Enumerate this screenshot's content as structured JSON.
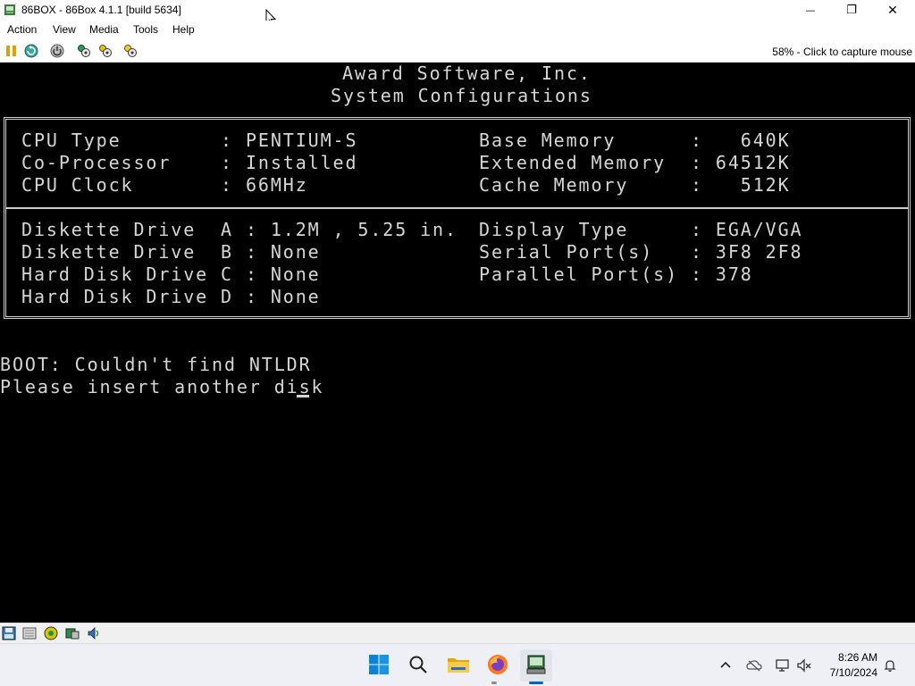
{
  "window": {
    "title": "86BOX - 86Box 4.1.1 [build 5634]",
    "minimize_glyph": "—",
    "maximize_glyph": "❐",
    "close_glyph": "✕"
  },
  "menu": [
    {
      "label": "Action"
    },
    {
      "label": "View"
    },
    {
      "label": "Media"
    },
    {
      "label": "Tools"
    },
    {
      "label": "Help"
    }
  ],
  "toolbar": {
    "icons": [
      "pause-icon",
      "reset-icon",
      "power-icon",
      "settings-icon",
      "hard-reset-icon",
      "ctrl-alt-del-icon"
    ],
    "capture_text": "58% - Click to capture mouse"
  },
  "bios": {
    "vendor": "Award Software, Inc.",
    "heading": "System Configurations",
    "left_top": [
      "CPU Type        : PENTIUM-S",
      "Co-Processor    : Installed",
      "CPU Clock       : 66MHz"
    ],
    "right_top": [
      "Base Memory      :   640K",
      "Extended Memory  : 64512K",
      "Cache Memory     :   512K"
    ],
    "left_bottom": [
      "Diskette Drive  A : 1.2M , 5.25 in.",
      "Diskette Drive  B : None",
      "Hard Disk Drive C : None",
      "Hard Disk Drive D : None"
    ],
    "right_bottom": [
      "Display Type     : EGA/VGA",
      "Serial Port(s)   : 3F8 2F8",
      "Parallel Port(s) : 378"
    ],
    "boot_line1": "BOOT: Couldn't find NTLDR",
    "boot_line2": "Please insert another disk"
  },
  "statusbar": {
    "icons": [
      "floppy-icon",
      "cdrom-icon",
      "network-icon",
      "hdd-icon",
      "sound-icon"
    ]
  },
  "taskbar": {
    "apps": [
      "start-icon",
      "search-icon",
      "file-explorer-icon",
      "firefox-icon",
      "86box-app-icon"
    ],
    "tray": [
      "chevron-up-icon",
      "onedrive-icon",
      "network-icon",
      "volume-icon",
      "notification-icon"
    ],
    "time": "8:26 AM",
    "date": "7/10/2024"
  },
  "colors": {
    "screen_bg": "#000000",
    "screen_text": "#d6d6d6",
    "taskbar_bg": "#eef0f5",
    "accent": "#0067c0"
  }
}
